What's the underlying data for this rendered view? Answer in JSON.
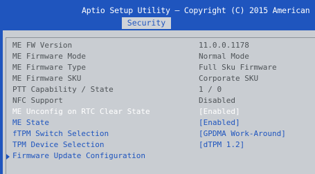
{
  "header": {
    "title": "Aptio Setup Utility – Copyright (C) 2015 American",
    "active_tab": "Security"
  },
  "items": [
    {
      "label": "ME FW Version",
      "value": "11.0.0.1178"
    },
    {
      "label": "ME Firmware Mode",
      "value": "Normal Mode"
    },
    {
      "label": "ME Firmware Type",
      "value": "Full Sku Firmware"
    },
    {
      "label": "ME Firmware SKU",
      "value": "Corporate SKU"
    },
    {
      "label": "PTT Capability / State",
      "value": "1 / 0"
    },
    {
      "label": "NFC Support",
      "value": "Disabled"
    },
    {
      "label": "ME Unconfig on RTC Clear State",
      "value": "[Enabled]"
    },
    {
      "label": "ME State",
      "value": "[Enabled]"
    },
    {
      "label": "fTPM Switch Selection",
      "value": "[GPDMA Work-Around]"
    },
    {
      "label": "TPM Device Selection",
      "value": "[dTPM 1.2]"
    },
    {
      "label": "Firmware Update Configuration",
      "value": ""
    }
  ],
  "colors": {
    "header_bg": "#1f55be",
    "panel_bg": "#c9cdd2",
    "highlight": "#ffffff",
    "link": "#1f55be"
  }
}
